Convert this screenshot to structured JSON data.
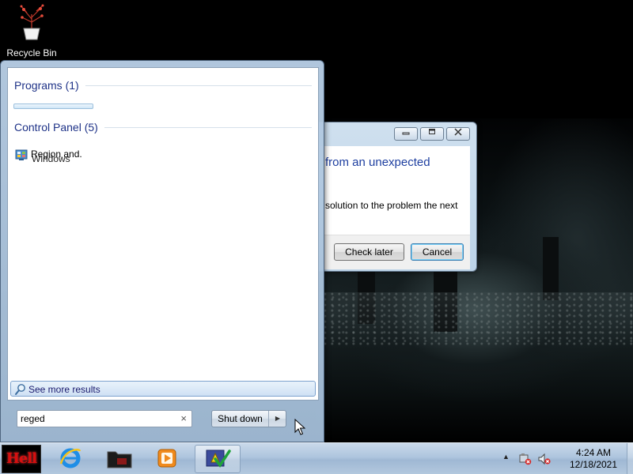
{
  "desktop": {
    "icons": [
      {
        "label": "Recycle Bin",
        "icon": "recycle-bin-icon"
      }
    ]
  },
  "dialog": {
    "heading": "from an unexpected",
    "message": "solution to the problem the next",
    "controls": {
      "minimize": "minimize-icon",
      "maximize": "maximize-icon",
      "close": "close-icon"
    },
    "buttons": {
      "check_later": "Check later",
      "cancel": "Cancel"
    }
  },
  "start_menu": {
    "groups": [
      {
        "header": "Programs (1)"
      },
      {
        "header": "Control Panel (5)"
      }
    ],
    "control_panel_item": {
      "label": "Region and.",
      "overlap_label": "Windows",
      "icon": "control-panel-icon"
    },
    "see_more": {
      "label": "See more results",
      "icon": "search-icon"
    },
    "search": {
      "value": "reged",
      "clear_symbol": "×"
    },
    "shutdown": {
      "label": "Shut down",
      "arrow": "▶"
    }
  },
  "taskbar": {
    "start_button": {
      "label": "Hell",
      "color": "#d80f0f"
    },
    "pinned": [
      {
        "name": "internet-explorer-icon"
      },
      {
        "name": "folder-icon"
      },
      {
        "name": "media-player-icon"
      },
      {
        "name": "photo-editor-icon",
        "active": true
      }
    ],
    "tray": {
      "show_hidden": "▲",
      "icons": [
        "action-center-icon",
        "volume-muted-icon"
      ]
    },
    "clock": {
      "time": "4:24 AM",
      "date": "12/18/2021"
    }
  },
  "colors": {
    "link_blue": "#1e3287",
    "dialog_heading": "#1e3fa0",
    "start_brand_red": "#d80f0f"
  }
}
